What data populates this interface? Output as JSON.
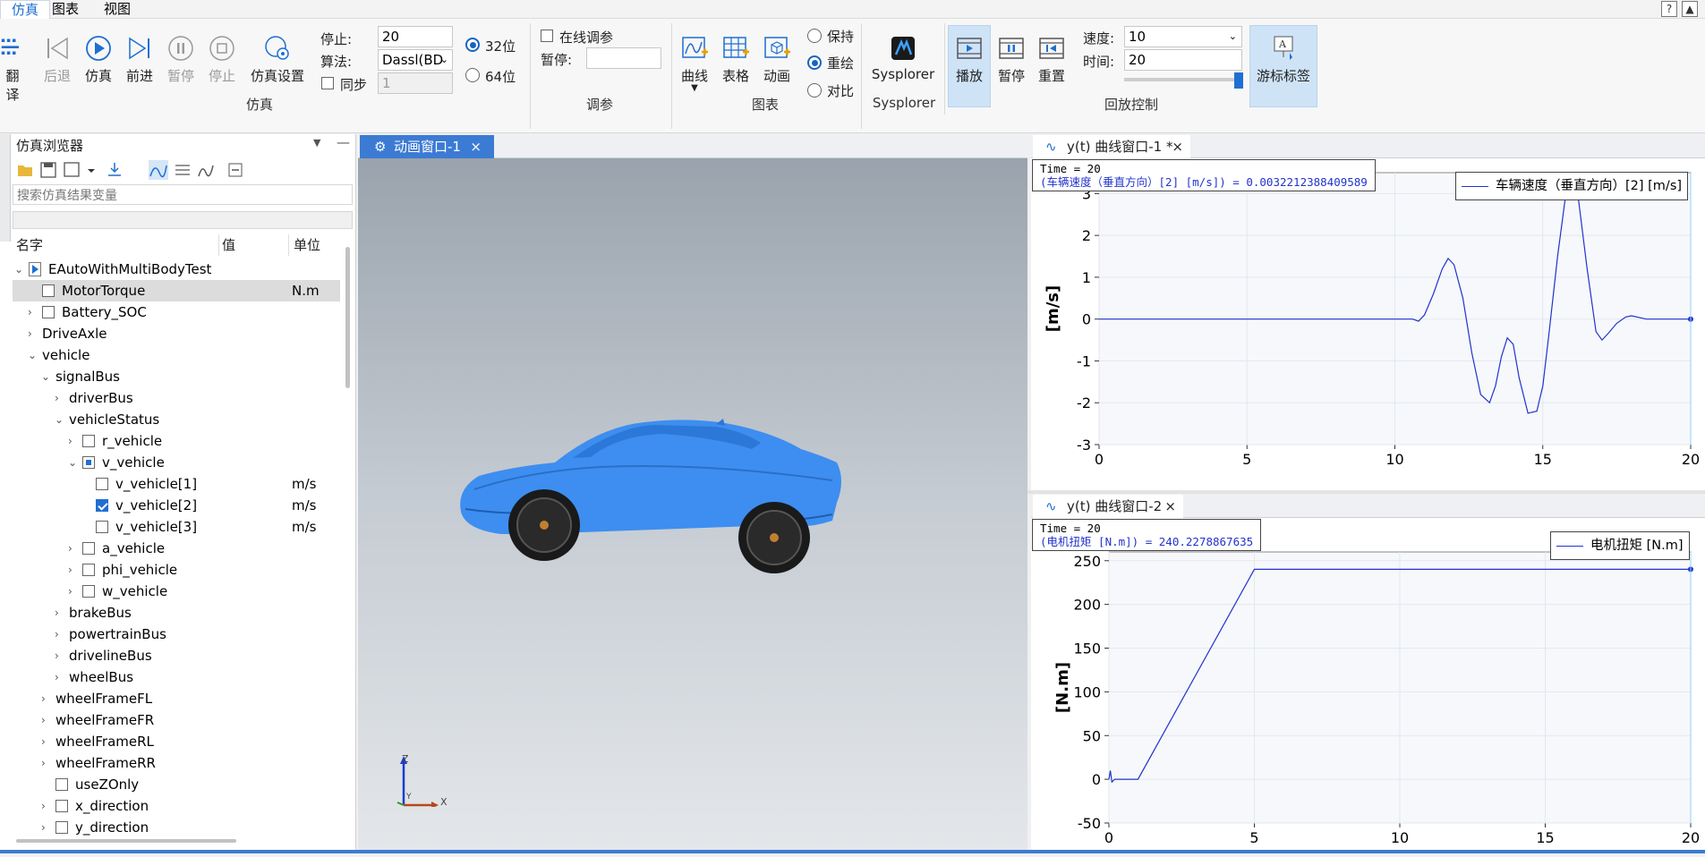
{
  "menu": {
    "items": [
      "仿真",
      "图表",
      "视图"
    ]
  },
  "toolbar": {
    "translate": "翻译",
    "back": "后退",
    "simulate": "仿真",
    "forward": "前进",
    "pause": "暂停",
    "stop": "停止",
    "sim_settings": "仿真设置",
    "stop_label": "停止:",
    "stop_value": "20",
    "algo_label": "算法:",
    "algo_value": "Dassl(BD",
    "sync_label": "同步",
    "sync_value": "1",
    "bit32": "32位",
    "bit64": "64位",
    "online_tune": "在线调参",
    "pause_label": "暂停:",
    "curve": "曲线",
    "table": "表格",
    "animation": "动画",
    "hold": "保持",
    "overlay": "重绘",
    "compare": "对比",
    "sysplorer": "Sysplorer",
    "play": "播放",
    "pause2": "暂停",
    "reset": "重置",
    "speed_label": "速度:",
    "speed_value": "10",
    "time_label": "时间:",
    "time_value": "20",
    "cursor_label": "游标标签",
    "groups": {
      "sim": "仿真",
      "tune": "调参",
      "chart": "图表",
      "sysplorer": "Sysplorer",
      "playback": "回放控制"
    }
  },
  "browser": {
    "title": "仿真浏览器",
    "search_placeholder": "搜索仿真结果变量",
    "columns": {
      "name": "名字",
      "value": "值",
      "unit": "单位"
    },
    "rows": [
      {
        "label": "EAutoWithMultiBodyTest",
        "unit": ""
      },
      {
        "label": "MotorTorque",
        "unit": "N.m"
      },
      {
        "label": "Battery_SOC",
        "unit": ""
      },
      {
        "label": "DriveAxle",
        "unit": ""
      },
      {
        "label": "vehicle",
        "unit": ""
      },
      {
        "label": "signalBus",
        "unit": ""
      },
      {
        "label": "driverBus",
        "unit": ""
      },
      {
        "label": "vehicleStatus",
        "unit": ""
      },
      {
        "label": "r_vehicle",
        "unit": ""
      },
      {
        "label": "v_vehicle",
        "unit": ""
      },
      {
        "label": "v_vehicle[1]",
        "unit": "m/s"
      },
      {
        "label": "v_vehicle[2]",
        "unit": "m/s"
      },
      {
        "label": "v_vehicle[3]",
        "unit": "m/s"
      },
      {
        "label": "a_vehicle",
        "unit": ""
      },
      {
        "label": "phi_vehicle",
        "unit": ""
      },
      {
        "label": "w_vehicle",
        "unit": ""
      },
      {
        "label": "brakeBus",
        "unit": ""
      },
      {
        "label": "powertrainBus",
        "unit": ""
      },
      {
        "label": "drivelineBus",
        "unit": ""
      },
      {
        "label": "wheelBus",
        "unit": ""
      },
      {
        "label": "wheelFrameFL",
        "unit": ""
      },
      {
        "label": "wheelFrameFR",
        "unit": ""
      },
      {
        "label": "wheelFrameRL",
        "unit": ""
      },
      {
        "label": "wheelFrameRR",
        "unit": ""
      },
      {
        "label": "useZOnly",
        "unit": ""
      },
      {
        "label": "x_direction",
        "unit": ""
      },
      {
        "label": "y_direction",
        "unit": ""
      }
    ]
  },
  "animation": {
    "tab": "动画窗口-1",
    "axis_z": "Z",
    "axis_x": "X",
    "axis_y": "Y"
  },
  "plot1": {
    "tab": "y(t) 曲线窗口-1 *",
    "time_line": "Time = 20",
    "value_line": "(车辆速度（垂直方向）[2] [m/s]) = 0.0032212388409589",
    "legend": "车辆速度（垂直方向）[2] [m/s]"
  },
  "plot2": {
    "tab": "y(t) 曲线窗口-2",
    "time_line": "Time = 20",
    "value_line": "(电机扭矩 [N.m]) = 240.2278867635",
    "legend": "电机扭矩 [N.m]"
  },
  "chart_data": [
    {
      "type": "line",
      "ylabel": "[m/s]",
      "xlim": [
        0,
        20
      ],
      "ylim": [
        -3,
        3.5
      ],
      "xticks": [
        "0",
        "5",
        "10",
        "15",
        "20"
      ],
      "yticks": [
        "3",
        "2",
        "1",
        "0",
        "-1",
        "-2",
        "-3"
      ],
      "series": [
        {
          "name": "车辆速度（垂直方向）[2] [m/s]",
          "color": "#2233cc",
          "x": [
            0,
            10.6,
            10.8,
            11.0,
            11.3,
            11.6,
            11.8,
            12.0,
            12.3,
            12.6,
            12.9,
            13.2,
            13.4,
            13.6,
            13.8,
            14.0,
            14.2,
            14.5,
            14.8,
            15.0,
            15.2,
            15.5,
            15.8,
            16.0,
            16.2,
            16.5,
            16.8,
            17.0,
            17.2,
            17.5,
            17.8,
            18.0,
            18.5,
            19.0,
            20.0
          ],
          "y": [
            0,
            0,
            -0.05,
            0.1,
            0.6,
            1.2,
            1.45,
            1.3,
            0.5,
            -0.8,
            -1.8,
            -2.0,
            -1.6,
            -0.9,
            -0.45,
            -0.6,
            -1.4,
            -2.25,
            -2.2,
            -1.6,
            -0.4,
            1.5,
            3.1,
            3.4,
            2.9,
            1.2,
            -0.3,
            -0.5,
            -0.35,
            -0.1,
            0.05,
            0.08,
            0.0,
            0.0,
            0.0
          ]
        }
      ]
    },
    {
      "type": "line",
      "ylabel": "[N.m]",
      "xlim": [
        0,
        20
      ],
      "ylim": [
        -50,
        260
      ],
      "xticks": [
        "0",
        "5",
        "10",
        "15",
        "20"
      ],
      "yticks": [
        "250",
        "200",
        "150",
        "100",
        "50",
        "0",
        "-50"
      ],
      "series": [
        {
          "name": "电机扭矩 [N.m]",
          "color": "#2233cc",
          "x": [
            0,
            0.05,
            0.1,
            0.2,
            1.0,
            5.0,
            20.0
          ],
          "y": [
            0,
            10,
            -3,
            0,
            0,
            240.2,
            240.2
          ]
        }
      ]
    }
  ]
}
